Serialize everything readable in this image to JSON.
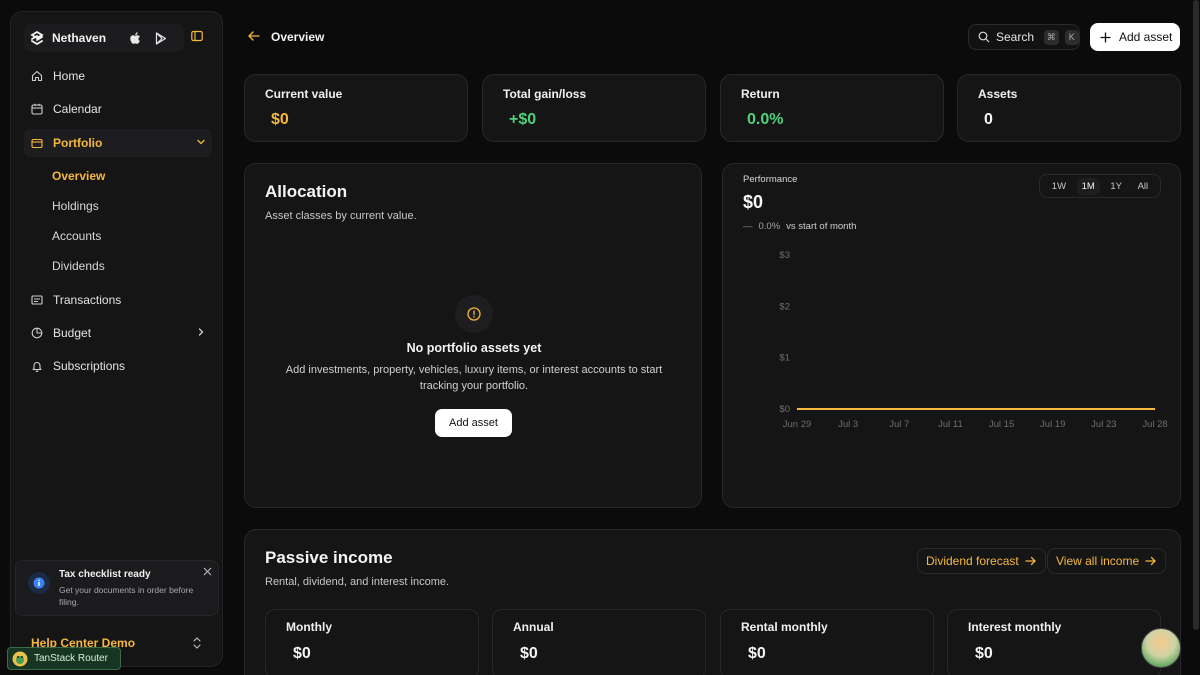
{
  "brand": {
    "name": "Nethaven"
  },
  "sidebar": {
    "items": [
      {
        "label": "Home",
        "icon": "home-icon"
      },
      {
        "label": "Calendar",
        "icon": "calendar-icon"
      },
      {
        "label": "Portfolio",
        "icon": "wallet-icon",
        "active": true
      },
      {
        "label": "Transactions",
        "icon": "receipt-icon"
      },
      {
        "label": "Budget",
        "icon": "pie-chart-icon"
      },
      {
        "label": "Subscriptions",
        "icon": "bell-icon"
      }
    ],
    "portfolio_sub": [
      "Overview",
      "Holdings",
      "Accounts",
      "Dividends"
    ]
  },
  "toast": {
    "title": "Tax checklist ready",
    "body": "Get your documents in order before filing."
  },
  "help_center": "Help Center Demo",
  "devtools": {
    "label": "TanStack Router"
  },
  "header": {
    "title": "Overview",
    "search_label": "Search",
    "kbd": [
      "⌘",
      "K"
    ],
    "add_asset": "Add asset"
  },
  "stats": [
    {
      "label": "Current value",
      "value": "$0",
      "color": "#f5b83d"
    },
    {
      "label": "Total gain/loss",
      "value": "+$0",
      "color": "#4fd17a"
    },
    {
      "label": "Return",
      "value": "0.0%",
      "color": "#4fd17a"
    },
    {
      "label": "Assets",
      "value": "0",
      "color": "#f4f4f4"
    }
  ],
  "allocation": {
    "title": "Allocation",
    "subtitle": "Asset classes by current value.",
    "empty_title": "No portfolio assets yet",
    "empty_body": "Add investments, property, vehicles, luxury items, or interest accounts to start tracking your portfolio.",
    "button": "Add asset"
  },
  "performance": {
    "label": "Performance",
    "value": "$0",
    "change_dash": "—",
    "change_pct": "0.0%",
    "change_text": "vs start of month",
    "ranges": [
      "1W",
      "1M",
      "1Y",
      "All"
    ],
    "active_range": "1M"
  },
  "chart_data": {
    "type": "line",
    "x": [
      "Jun 29",
      "Jul 3",
      "Jul 7",
      "Jul 11",
      "Jul 15",
      "Jul 19",
      "Jul 23",
      "Jul 28"
    ],
    "y_ticks": [
      "$3",
      "$2",
      "$1",
      "$0"
    ],
    "ylim": [
      0,
      3
    ],
    "series": [
      {
        "values": [
          0,
          0,
          0,
          0,
          0,
          0,
          0,
          0
        ],
        "color": "#f5b83d"
      }
    ],
    "grid": false
  },
  "passive_income": {
    "title": "Passive income",
    "subtitle": "Rental, dividend, and interest income.",
    "forecast_btn": "Dividend forecast",
    "view_all_btn": "View all income",
    "cards": [
      {
        "label": "Monthly",
        "value": "$0"
      },
      {
        "label": "Annual",
        "value": "$0"
      },
      {
        "label": "Rental monthly",
        "value": "$0"
      },
      {
        "label": "Interest monthly",
        "value": "$0"
      }
    ]
  },
  "colors": {
    "accent": "#f5b83d",
    "positive": "#4fd17a",
    "background": "#0b0b0c",
    "card": "#151516"
  }
}
